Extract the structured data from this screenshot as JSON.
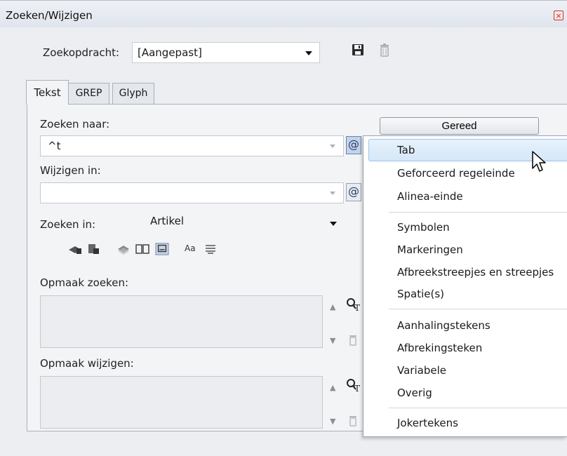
{
  "window": {
    "title": "Zoeken/Wijzigen",
    "close_glyph": "×"
  },
  "query": {
    "label": "Zoekopdracht:",
    "value": "[Aangepast]",
    "save_icon": "floppy-disk-icon",
    "delete_icon": "trash-icon"
  },
  "tabs": [
    "Tekst",
    "GREP",
    "Glyph"
  ],
  "find": {
    "label": "Zoeken naar:",
    "value": "^t",
    "special_char_glyph": "@"
  },
  "change": {
    "label": "Wijzigen in:",
    "value": "",
    "special_char_glyph": "@"
  },
  "done_button": "Gereed",
  "search_in": {
    "label": "Zoeken in:",
    "value": "Artikel"
  },
  "toolbar": {
    "case_label": "Aa",
    "icons": [
      "locked-layers-icon",
      "locked-stories-icon",
      "hidden-layers-icon",
      "master-pages-icon",
      "footnotes-icon",
      "case-sensitive-icon",
      "whole-word-icon"
    ]
  },
  "find_format": {
    "label": "Opmaak zoeken:"
  },
  "change_format": {
    "label": "Opmaak wijzigen:"
  },
  "menu": {
    "groups": [
      [
        "Tab",
        "Geforceerd regeleinde",
        "Alinea-einde"
      ],
      [
        "Symbolen",
        "Markeringen",
        "Afbreekstreepjes en streepjes",
        "Spatie(s)"
      ],
      [
        "Aanhalingstekens",
        "Afbrekingsteken",
        "Variabele",
        "Overig"
      ],
      [
        "Jokertekens"
      ]
    ],
    "highlighted": "Tab"
  },
  "colors": {
    "highlight": "#d5e7f8",
    "close": "#c0392b"
  }
}
